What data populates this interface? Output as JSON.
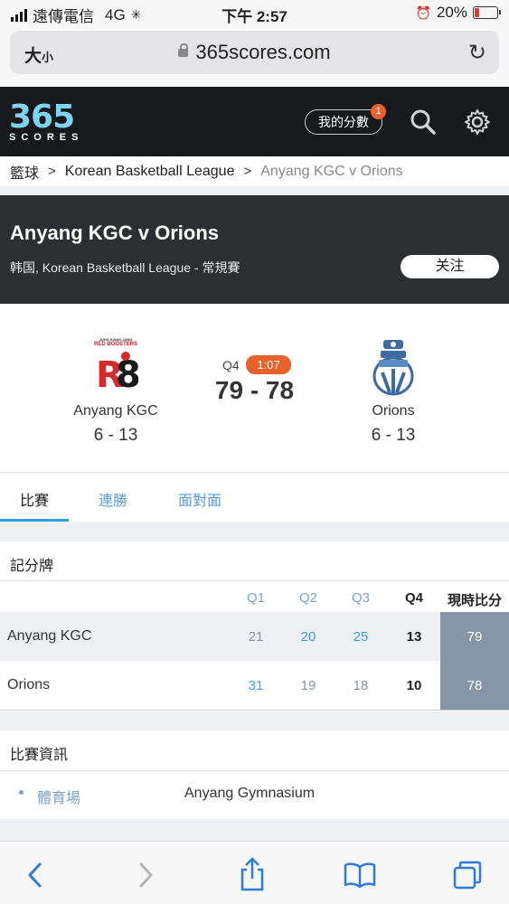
{
  "status_bar": {
    "carrier": "遠傳電信",
    "network": "4G",
    "time": "下午 2:57",
    "battery": "20%"
  },
  "browser": {
    "text_size_label": "大",
    "text_size_small": "小",
    "url": "365scores.com"
  },
  "site_header": {
    "logo_number": "365",
    "logo_sub": "SCORES",
    "my_scores_label": "我的分數",
    "my_scores_badge": "1"
  },
  "breadcrumb": {
    "items": [
      "籃球",
      "Korean Basketball League",
      "Anyang KGC v Orions"
    ]
  },
  "match": {
    "title": "Anyang KGC v Orions",
    "subtitle": "韩国, Korean Basketball League - 常規賽",
    "follow_label": "关注",
    "period": "Q4",
    "clock": "1:07",
    "score": "79 - 78",
    "home": {
      "name": "Anyang KGC",
      "record": "6 - 13",
      "logo_text_top": "JUNG KWAN JANG",
      "logo_text": "RED BOOSTERS"
    },
    "away": {
      "name": "Orions",
      "record": "6 - 13"
    }
  },
  "tabs": [
    "比賽",
    "連勝",
    "面對面"
  ],
  "box_score": {
    "title": "記分牌",
    "headers": [
      "Q1",
      "Q2",
      "Q3",
      "Q4",
      "現時比分"
    ],
    "rows": [
      {
        "team": "Anyang KGC",
        "q": [
          "21",
          "20",
          "25",
          "13"
        ],
        "total": "79"
      },
      {
        "team": "Orions",
        "q": [
          "31",
          "19",
          "18",
          "10"
        ],
        "total": "78"
      }
    ]
  },
  "match_info": {
    "title": "比賽資訊",
    "venue_label": "體育場",
    "venue_value": "Anyang Gymnasium"
  },
  "colors": {
    "accent_orange": "#e8612a",
    "link_blue": "#3aa0e0",
    "header_dark": "#17191b"
  }
}
